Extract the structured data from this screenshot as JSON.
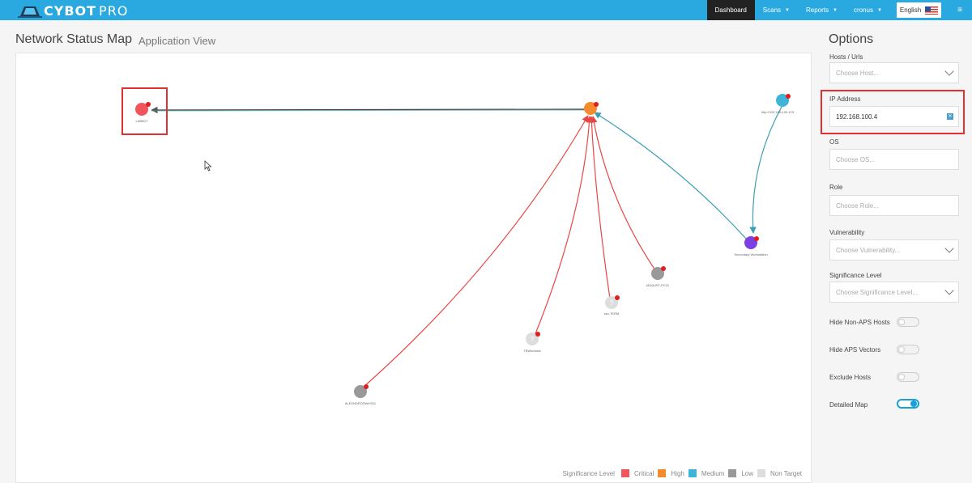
{
  "app": {
    "brand": "CYBOT",
    "brand_suffix": "PRO"
  },
  "nav": {
    "dashboard": "Dashboard",
    "scans": "Scans",
    "reports": "Reports",
    "user": "cronus",
    "language": "English"
  },
  "page": {
    "title": "Network Status Map",
    "subtitle": "Application View"
  },
  "map": {
    "nodes": [
      {
        "label": "LAB5G7",
        "significance": "Critical"
      },
      {
        "label": "",
        "significance": "High"
      },
      {
        "label": "http://192.168.100.123",
        "significance": "Medium"
      },
      {
        "label": "Secondary Workstation",
        "significance": "Purple"
      },
      {
        "label": "MAQUST-PC01",
        "significance": "Low"
      },
      {
        "label": "sec.TERM",
        "significance": "Non Target"
      },
      {
        "label": "TBWindows",
        "significance": "Non Target"
      },
      {
        "label": "ALEXNDROSWKS01",
        "significance": "Low"
      }
    ],
    "colors": {
      "critical": "#f2545b",
      "high": "#f58a2f",
      "medium": "#3fb4d8",
      "low": "#999999",
      "non_target": "#dddddd",
      "purple": "#7b3fe4",
      "edge_red": "#e84646",
      "edge_teal": "#3a9fb3"
    }
  },
  "legend": {
    "title": "Significance Level",
    "items": [
      {
        "label": "Critical",
        "color": "#f2545b"
      },
      {
        "label": "High",
        "color": "#f58a2f"
      },
      {
        "label": "Medium",
        "color": "#3fb4d8"
      },
      {
        "label": "Low",
        "color": "#999999"
      },
      {
        "label": "Non Target",
        "color": "#dddddd"
      }
    ]
  },
  "options": {
    "title": "Options",
    "hosts_label": "Hosts / Urls",
    "hosts_placeholder": "Choose Host...",
    "ip_label": "IP Address",
    "ip_value": "192.168.100.4",
    "os_label": "OS",
    "os_placeholder": "Choose OS...",
    "role_label": "Role",
    "role_placeholder": "Choose Role...",
    "vuln_label": "Vulnerability",
    "vuln_placeholder": "Choose Vulnerability...",
    "sig_label": "Significance Level",
    "sig_placeholder": "Choose Significance Level...",
    "toggles": [
      {
        "label": "Hide Non-APS Hosts",
        "on": false
      },
      {
        "label": "Hide APS Vectors",
        "on": false
      },
      {
        "label": "Exclude Hosts",
        "on": false
      },
      {
        "label": "Detailed Map",
        "on": true
      }
    ]
  }
}
